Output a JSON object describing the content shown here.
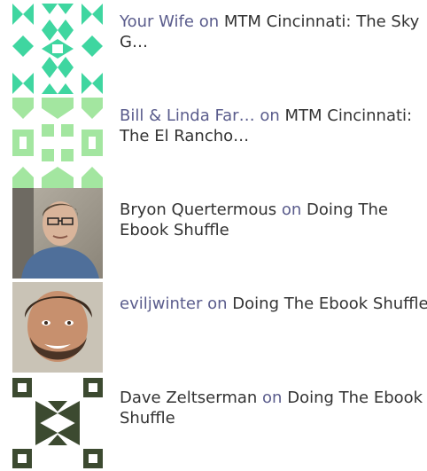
{
  "comments": [
    {
      "author": "Your Wife",
      "on": "on",
      "post": "MTM Cincinnati: The Sky G…",
      "avatar": "identicon-teal"
    },
    {
      "author": "Bill & Linda Far…",
      "on": "on",
      "post": "MTM Cincinnati: The El Rancho…",
      "avatar": "identicon-green"
    },
    {
      "author": "Bryon Quertermous",
      "on": "on",
      "post": "Doing The Ebook Shuffle",
      "avatar": "photo-man-with-glasses"
    },
    {
      "author": "eviljwinter",
      "on": "on",
      "post": "Doing The Ebook Shuffle",
      "avatar": "photo-bearded-man"
    },
    {
      "author": "Dave Zeltserman",
      "on": "on",
      "post": "Doing The Ebook Shuffle",
      "avatar": "identicon-olive"
    }
  ],
  "colors": {
    "link": "#5a5c8c",
    "text": "#333333",
    "identicon_teal": "#3fd6a0",
    "identicon_green": "#a3e6a0",
    "identicon_olive": "#3c4a30"
  }
}
